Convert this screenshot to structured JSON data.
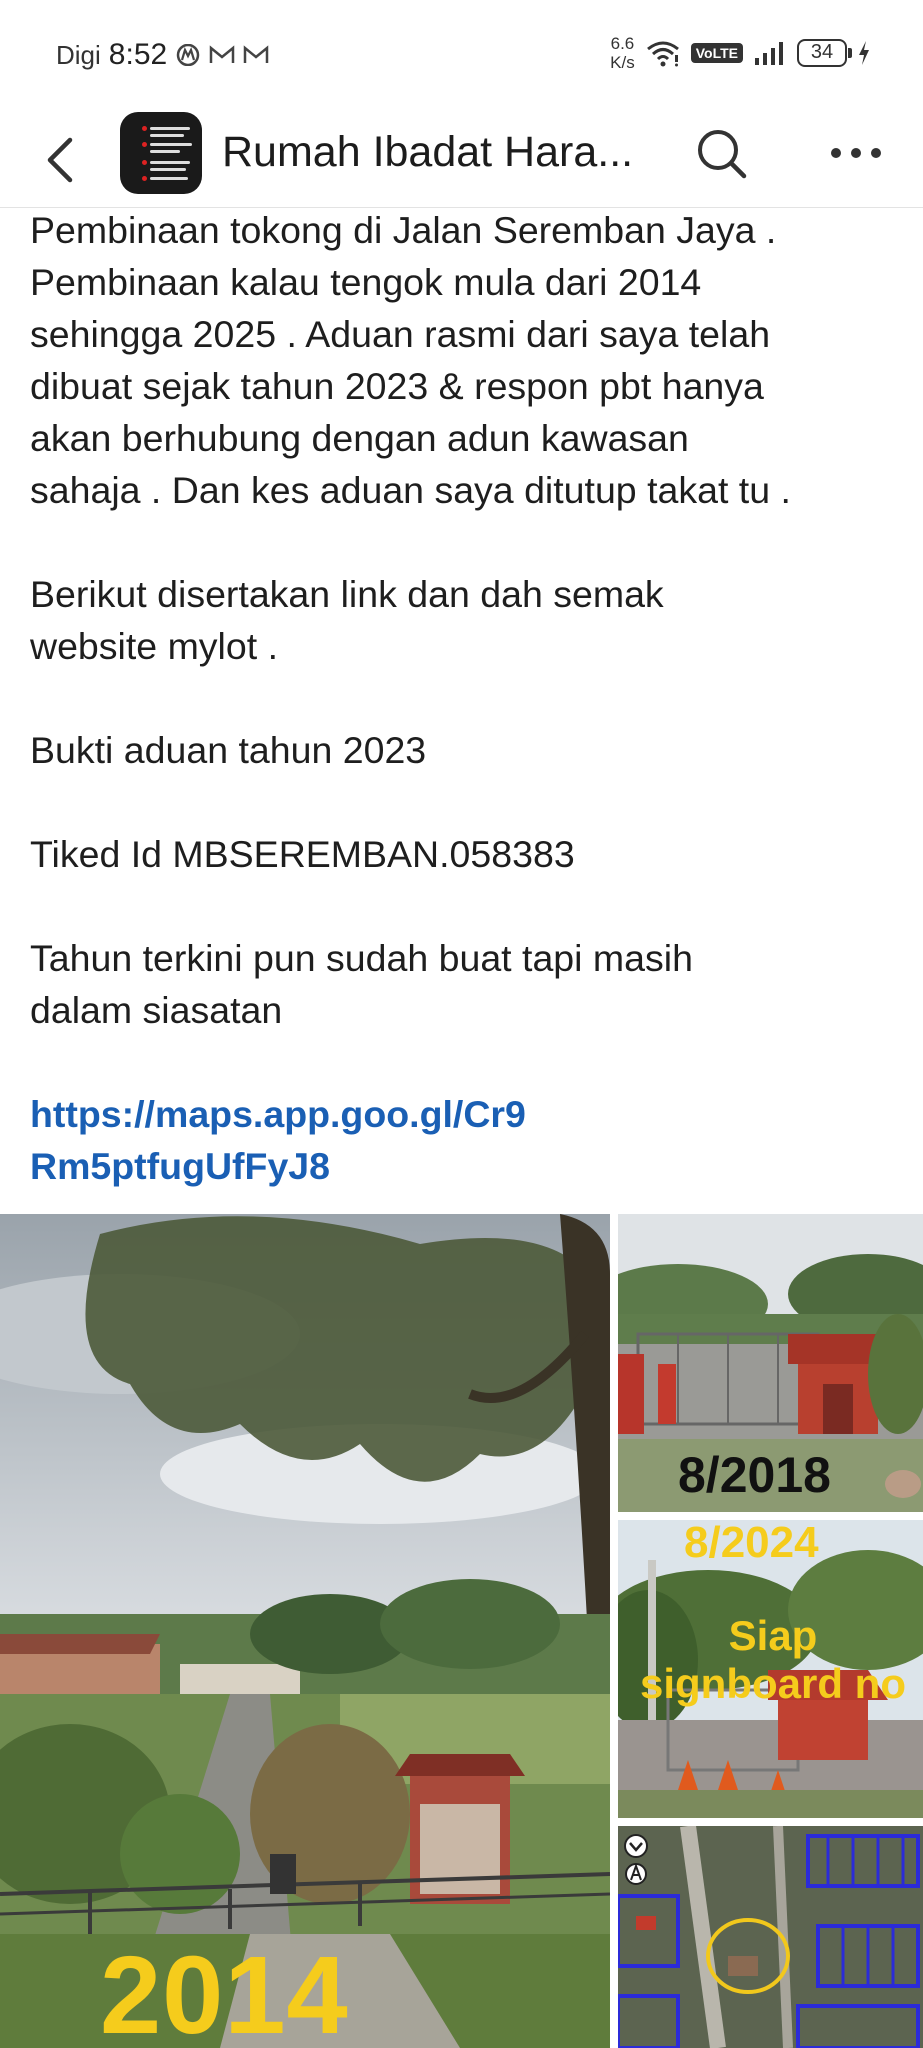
{
  "status_bar": {
    "carrier": "Digi",
    "time": "8:52",
    "net_speed_value": "6.6",
    "net_speed_unit": "K/s",
    "volte": "VoLTE",
    "battery": "34"
  },
  "header": {
    "title": "Rumah Ibadat Hara..."
  },
  "post": {
    "paragraphs": [
      "Pembinaan tokong di Jalan Seremban Jaya .\nPembinaan kalau tengok mula dari 2014\nsehingga 2025 . Aduan rasmi dari saya telah\ndibuat sejak tahun 2023 & respon pbt hanya\nakan berhubung dengan adun kawasan\nsahaja . Dan kes aduan saya ditutup takat tu .",
      "Berikut disertakan link dan dah semak\nwebsite mylot .",
      "Bukti aduan tahun 2023",
      "Tiked Id MBSEREMBAN.058383",
      "Tahun terkini pun sudah buat tapi masih\ndalam siasatan"
    ],
    "link": "https://maps.app.goo.gl/Cr9Rm5ptfugUfFyJ8"
  },
  "photos": {
    "main_label": "2014",
    "photo2_label": "8/2018",
    "photo3_label": "8/2024",
    "photo3_caption": "Siap signboard no"
  },
  "colors": {
    "link": "#1a5fb4",
    "overlay_yellow": "#f5cc1c"
  }
}
